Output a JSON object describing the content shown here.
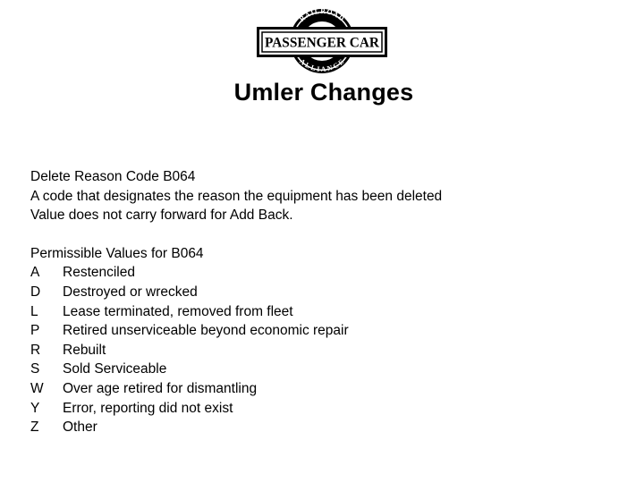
{
  "logo": {
    "top_arc_text": "RAILROAD",
    "band_text": "PASSENGER CAR",
    "bottom_arc_text": "ALLIANCE"
  },
  "title": "Umler Changes",
  "definition": {
    "heading": "Delete Reason Code B064",
    "lines": [
      "A code that designates the reason the equipment has been deleted",
      "Value does not carry forward for Add Back."
    ]
  },
  "permissible": {
    "heading": "Permissible Values for B064",
    "values": [
      {
        "code": "A",
        "description": "Restenciled"
      },
      {
        "code": "D",
        "description": "Destroyed or wrecked"
      },
      {
        "code": "L",
        "description": "Lease terminated, removed from fleet"
      },
      {
        "code": "P",
        "description": "Retired unserviceable beyond economic repair"
      },
      {
        "code": "R",
        "description": "Rebuilt"
      },
      {
        "code": "S",
        "description": "Sold Serviceable"
      },
      {
        "code": "W",
        "description": "Over age retired for dismantling"
      },
      {
        "code": "Y",
        "description": "Error, reporting did not exist"
      },
      {
        "code": "Z",
        "description": "Other"
      }
    ]
  }
}
